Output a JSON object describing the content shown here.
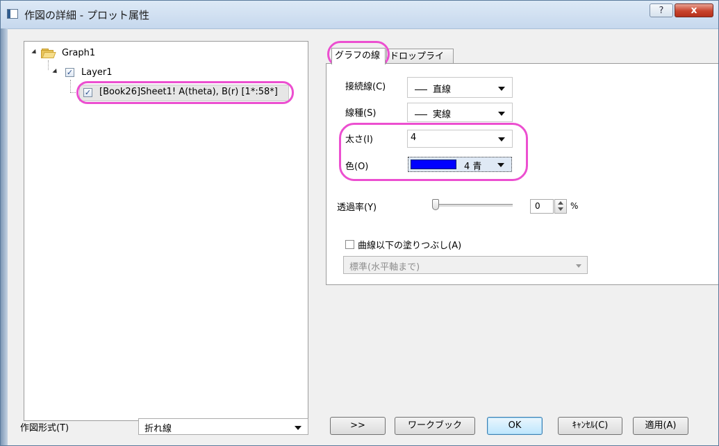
{
  "window": {
    "title": "作図の詳細 - プロット属性",
    "help_label": "?",
    "close_label": "x"
  },
  "tree": {
    "graph_label": "Graph1",
    "layer_label": "Layer1",
    "plot_label": "[Book26]Sheet1! A(theta), B(r) [1*:58*]",
    "layer_checked": "✓",
    "plot_checked": "✓"
  },
  "tabs": [
    {
      "label": "グラフの線",
      "active": true
    },
    {
      "label": "ドロップライン",
      "active": false
    }
  ],
  "line_tab": {
    "connect_label": "接続線(C)",
    "connect_value": "直線",
    "style_label": "線種(S)",
    "style_value": "実線",
    "width_label": "太さ(I)",
    "width_value": "4",
    "color_label": "色(O)",
    "color_value": "4 青",
    "color_hex": "#0000ff",
    "transparency_label": "透過率(Y)",
    "transparency_value": "0",
    "transparency_unit": "%",
    "fill_label": "曲線以下の塗りつぶし(A)",
    "fill_checked": false,
    "fill_mode_value": "標準(水平軸まで)"
  },
  "footer": {
    "plot_type_label": "作図形式(T)",
    "plot_type_value": "折れ線",
    "expand_button": ">>",
    "workbook_button": "ワークブック",
    "ok_button": "OK",
    "cancel_button": "ｷｬﾝｾﾙ(C)",
    "apply_button": "適用(A)"
  },
  "colors": {
    "highlight_ring": "#ec4fd0",
    "ok_border": "#3c7fb1"
  }
}
